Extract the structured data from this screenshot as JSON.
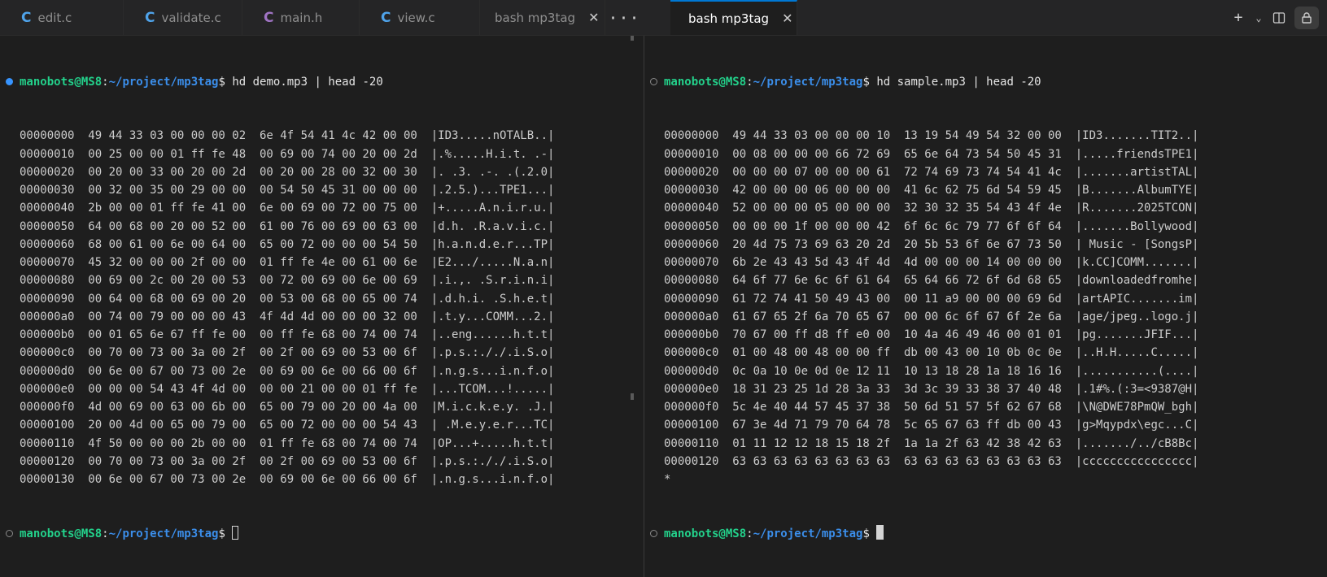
{
  "editor_tabs": [
    {
      "icon": "C",
      "label": "edit.c"
    },
    {
      "icon": "C",
      "label": "validate.c"
    },
    {
      "icon": "C",
      "label": "main.h"
    },
    {
      "icon": "C",
      "label": "view.c"
    }
  ],
  "left_terminal_tab": {
    "label": "bash  mp3tag",
    "close": "✕"
  },
  "more_actions": "···",
  "right_terminal_tab": {
    "label": "bash  mp3tag",
    "close": "✕"
  },
  "right_actions": {
    "add": "+",
    "dropdown": "⌄",
    "split": "◫",
    "lock": "🔒"
  },
  "prompt": {
    "user": "manobots@MS8",
    "sep": ":",
    "path": "~/project/mp3tag",
    "dollar": "$"
  },
  "left_terminal": {
    "command": " hd demo.mp3 | head -20",
    "lines": [
      "00000000  49 44 33 03 00 00 00 02  6e 4f 54 41 4c 42 00 00  |ID3.....nOTALB..|",
      "00000010  00 25 00 00 01 ff fe 48  00 69 00 74 00 20 00 2d  |.%.....H.i.t. .-|",
      "00000020  00 20 00 33 00 20 00 2d  00 20 00 28 00 32 00 30  |. .3. .-. .(.2.0|",
      "00000030  00 32 00 35 00 29 00 00  00 54 50 45 31 00 00 00  |.2.5.)...TPE1...|",
      "00000040  2b 00 00 01 ff fe 41 00  6e 00 69 00 72 00 75 00  |+.....A.n.i.r.u.|",
      "00000050  64 00 68 00 20 00 52 00  61 00 76 00 69 00 63 00  |d.h. .R.a.v.i.c.|",
      "00000060  68 00 61 00 6e 00 64 00  65 00 72 00 00 00 54 50  |h.a.n.d.e.r...TP|",
      "00000070  45 32 00 00 00 2f 00 00  01 ff fe 4e 00 61 00 6e  |E2.../.....N.a.n|",
      "00000080  00 69 00 2c 00 20 00 53  00 72 00 69 00 6e 00 69  |.i.,. .S.r.i.n.i|",
      "00000090  00 64 00 68 00 69 00 20  00 53 00 68 00 65 00 74  |.d.h.i. .S.h.e.t|",
      "000000a0  00 74 00 79 00 00 00 43  4f 4d 4d 00 00 00 32 00  |.t.y...COMM...2.|",
      "000000b0  00 01 65 6e 67 ff fe 00  00 ff fe 68 00 74 00 74  |..eng......h.t.t|",
      "000000c0  00 70 00 73 00 3a 00 2f  00 2f 00 69 00 53 00 6f  |.p.s.:././.i.S.o|",
      "000000d0  00 6e 00 67 00 73 00 2e  00 69 00 6e 00 66 00 6f  |.n.g.s...i.n.f.o|",
      "000000e0  00 00 00 54 43 4f 4d 00  00 00 21 00 00 01 ff fe  |...TCOM...!.....|",
      "000000f0  4d 00 69 00 63 00 6b 00  65 00 79 00 20 00 4a 00  |M.i.c.k.e.y. .J.|",
      "00000100  20 00 4d 00 65 00 79 00  65 00 72 00 00 00 54 43  | .M.e.y.e.r...TC|",
      "00000110  4f 50 00 00 00 2b 00 00  01 ff fe 68 00 74 00 74  |OP...+.....h.t.t|",
      "00000120  00 70 00 73 00 3a 00 2f  00 2f 00 69 00 53 00 6f  |.p.s.:././.i.S.o|",
      "00000130  00 6e 00 67 00 73 00 2e  00 69 00 6e 00 66 00 6f  |.n.g.s...i.n.f.o|"
    ]
  },
  "right_terminal": {
    "command": " hd sample.mp3 | head -20",
    "lines": [
      "00000000  49 44 33 03 00 00 00 10  13 19 54 49 54 32 00 00  |ID3.......TIT2..|",
      "00000010  00 08 00 00 00 66 72 69  65 6e 64 73 54 50 45 31  |.....friendsTPE1|",
      "00000020  00 00 00 07 00 00 00 61  72 74 69 73 74 54 41 4c  |.......artistTAL|",
      "00000030  42 00 00 00 06 00 00 00  41 6c 62 75 6d 54 59 45  |B.......AlbumTYE|",
      "00000040  52 00 00 00 05 00 00 00  32 30 32 35 54 43 4f 4e  |R.......2025TCON|",
      "00000050  00 00 00 1f 00 00 00 42  6f 6c 6c 79 77 6f 6f 64  |.......Bollywood|",
      "00000060  20 4d 75 73 69 63 20 2d  20 5b 53 6f 6e 67 73 50  | Music - [SongsP|",
      "00000070  6b 2e 43 43 5d 43 4f 4d  4d 00 00 00 14 00 00 00  |k.CC]COMM.......|",
      "00000080  64 6f 77 6e 6c 6f 61 64  65 64 66 72 6f 6d 68 65  |downloadedfromhe|",
      "00000090  61 72 74 41 50 49 43 00  00 11 a9 00 00 00 69 6d  |artAPIC.......im|",
      "000000a0  61 67 65 2f 6a 70 65 67  00 00 6c 6f 67 6f 2e 6a  |age/jpeg..logo.j|",
      "000000b0  70 67 00 ff d8 ff e0 00  10 4a 46 49 46 00 01 01  |pg.......JFIF...|",
      "000000c0  01 00 48 00 48 00 00 ff  db 00 43 00 10 0b 0c 0e  |..H.H.....C.....|",
      "000000d0  0c 0a 10 0e 0d 0e 12 11  10 13 18 28 1a 18 16 16  |...........(....|",
      "000000e0  18 31 23 25 1d 28 3a 33  3d 3c 39 33 38 37 40 48  |.1#%.(:3=<9387@H|",
      "000000f0  5c 4e 40 44 57 45 37 38  50 6d 51 57 5f 62 67 68  |\\N@DWE78PmQW_bgh|",
      "00000100  67 3e 4d 71 79 70 64 78  5c 65 67 63 ff db 00 43  |g>Mqypdx\\egc...C|",
      "00000110  01 11 12 12 18 15 18 2f  1a 1a 2f 63 42 38 42 63  |......./../cB8Bc|",
      "00000120  63 63 63 63 63 63 63 63  63 63 63 63 63 63 63 63  |cccccccccccccccc|",
      "*"
    ]
  }
}
